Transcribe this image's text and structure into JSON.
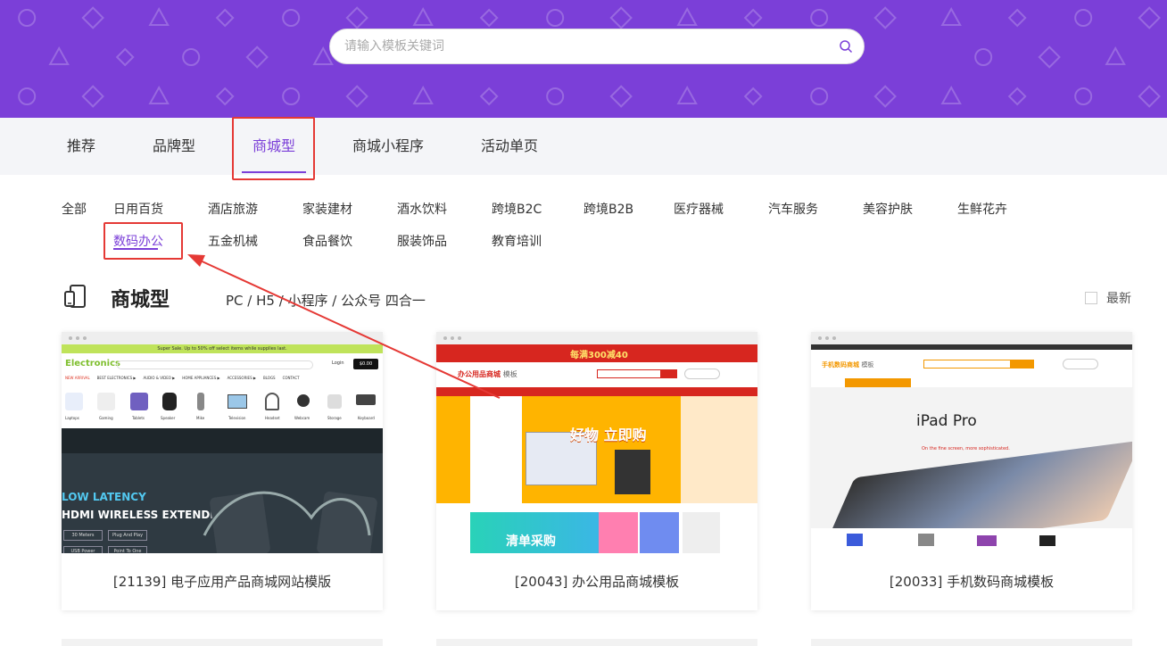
{
  "search": {
    "placeholder": "请输入模板关键词",
    "icon": "search-icon"
  },
  "tabs": [
    {
      "label": "推荐"
    },
    {
      "label": "品牌型"
    },
    {
      "label": "商城型",
      "active": true
    },
    {
      "label": "商城小程序"
    },
    {
      "label": "活动单页"
    }
  ],
  "categories": [
    {
      "label": "全部"
    },
    {
      "label": "日用百货"
    },
    {
      "label": "酒店旅游"
    },
    {
      "label": "家装建材"
    },
    {
      "label": "酒水饮料"
    },
    {
      "label": "跨境B2C"
    },
    {
      "label": "跨境B2B"
    },
    {
      "label": "医疗器械"
    },
    {
      "label": "汽车服务"
    },
    {
      "label": "美容护肤"
    },
    {
      "label": "生鲜花卉"
    },
    {
      "label": "数码办公",
      "active": true
    },
    {
      "label": "五金机械"
    },
    {
      "label": "食品餐饮"
    },
    {
      "label": "服装饰品"
    },
    {
      "label": "教育培训"
    }
  ],
  "section": {
    "title": "商城型",
    "subtitle": "PC / H5 / 小程序 / 公众号 四合一",
    "newest_label": "最新"
  },
  "cards": [
    {
      "caption": "[21139] 电子应用产品商城网站模版",
      "thumb": {
        "promo": "Super Sale. Up to 50% off select items while supplies last.",
        "logo": "Electronics",
        "login": "Login",
        "cart": "$0.00",
        "nav": [
          "NEW ARRIVAL",
          "BEST ELECTRONICS ▶",
          "AUDIO & VIDEO ▶",
          "HOME APPLIANCES ▶",
          "ACCESSORIES ▶",
          "BLOGS",
          "CONTACT"
        ],
        "categories": [
          "Laptops",
          "Gaming",
          "Tablets",
          "Speaker",
          "Mike",
          "Television",
          "Headset",
          "Webcam",
          "Storage",
          "Keyboard"
        ],
        "hero_line1": "LOW LATENCY",
        "hero_line2": "HDMI WIRELESS EXTENDER",
        "tags": [
          "30 Meters",
          "Plug And Play",
          "USB Power",
          "Point To One"
        ],
        "accent": "#bfe35a"
      }
    },
    {
      "caption": "[20043] 办公用品商城模板",
      "thumb": {
        "top_banner": "每满300减40",
        "logo": "办公用品商城",
        "logo_suffix": "模板",
        "hero_text": "好物 立即购",
        "section_text": "清单采购",
        "accent": "#d7261f"
      }
    },
    {
      "caption": "[20033] 手机数码商城模板",
      "thumb": {
        "logo": "手机数码商城",
        "logo_suffix": "模板",
        "hero_title": "iPad Pro",
        "hero_desc": "On the fine screen, more sophisticated.",
        "accent": "#f39800"
      }
    }
  ],
  "colors": {
    "brand": "#7b3fd8",
    "highlight": "#e53935"
  }
}
